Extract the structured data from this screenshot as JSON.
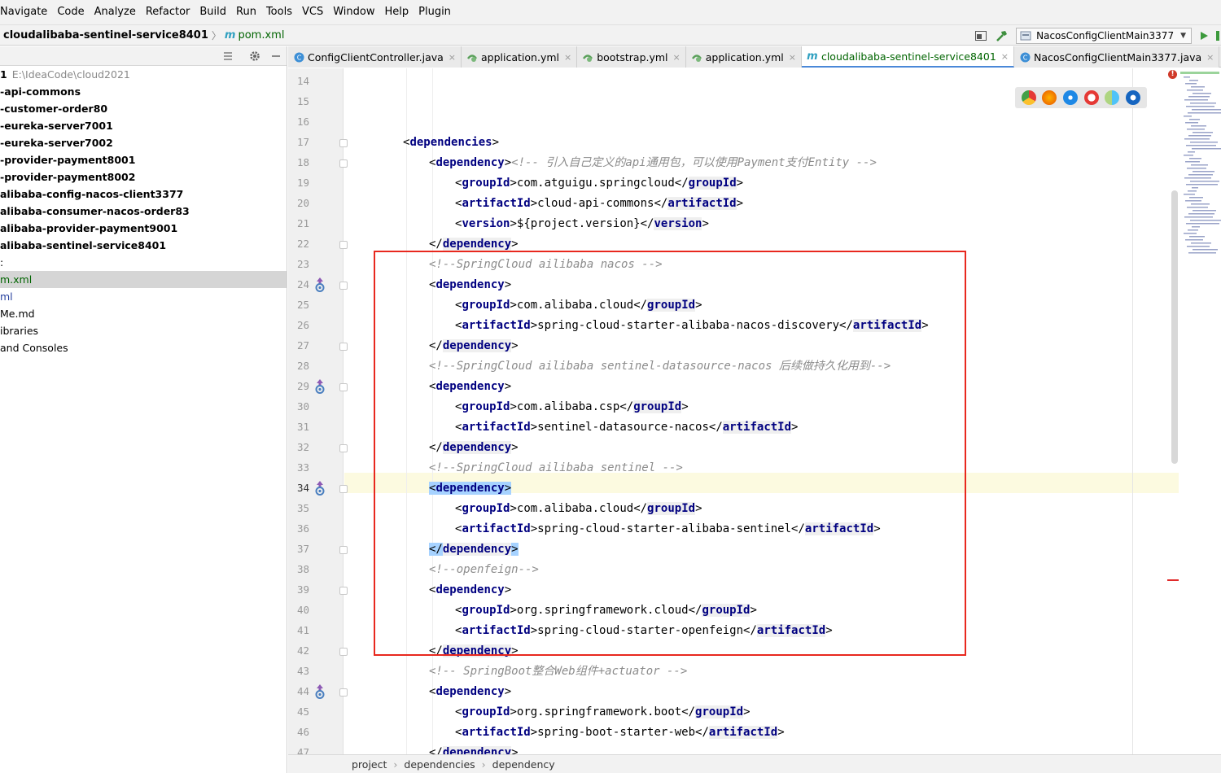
{
  "menu": [
    "Navigate",
    "Code",
    "Analyze",
    "Refactor",
    "Build",
    "Run",
    "Tools",
    "VCS",
    "Window",
    "Help",
    "Plugin"
  ],
  "nav": {
    "project": "cloudalibaba-sentinel-service8401",
    "file_prefix": "m",
    "file": "pom.xml",
    "run_config": "NacosConfigClientMain3377"
  },
  "project_tree": {
    "root_name": "1",
    "root_path": "E:\\IdeaCode\\cloud2021",
    "items": [
      "-api-commons",
      "-customer-order80",
      "-eureka-server7001",
      "-eureka-server7002",
      "-provider-payment8001",
      "-provider-payment8002",
      "alibaba-config-nacos-client3377",
      "alibaba-consumer-nacos-order83",
      "alibaba-provider-payment9001",
      "alibaba-sentinel-service8401",
      ":",
      "m.xml",
      "ml",
      "Me.md",
      "ibraries",
      " and Consoles"
    ]
  },
  "tabs": [
    {
      "label": "ConfigClientController.java",
      "icon": "java-class-icon"
    },
    {
      "label": "application.yml",
      "icon": "yml-icon"
    },
    {
      "label": "bootstrap.yml",
      "icon": "yml-icon"
    },
    {
      "label": "application.yml",
      "icon": "yml-icon"
    },
    {
      "label": "cloudalibaba-sentinel-service8401",
      "icon": "maven-icon",
      "active": true
    },
    {
      "label": "NacosConfigClientMain3377.java",
      "icon": "java-class-icon"
    }
  ],
  "code": {
    "line_numbers": [
      "14",
      "15",
      "16",
      "17",
      "18",
      "19",
      "20",
      "21",
      "22",
      "23",
      "24",
      "25",
      "26",
      "27",
      "28",
      "29",
      "30",
      "31",
      "32",
      "33",
      "34",
      "35",
      "36",
      "37",
      "38",
      "39",
      "40",
      "41",
      "42",
      "43",
      "44",
      "45",
      "46",
      "47"
    ],
    "current_line": "34",
    "lines": [
      {
        "ln": "14",
        "indent": 0,
        "parts": []
      },
      {
        "ln": "15",
        "indent": 0,
        "parts": []
      },
      {
        "ln": "16",
        "indent": 0,
        "parts": []
      },
      {
        "ln": "17",
        "indent": 1,
        "parts": [
          {
            "t": "open",
            "v": "dependencies"
          }
        ]
      },
      {
        "ln": "18",
        "indent": 2,
        "parts": [
          {
            "t": "open",
            "v": "dependency"
          },
          {
            "t": "cmt",
            "v": "<!-- 引入自己定义的api通用包，可以使用Payment支付Entity -->"
          }
        ]
      },
      {
        "ln": "19",
        "indent": 3,
        "parts": [
          {
            "t": "open",
            "v": "groupId"
          },
          {
            "t": "txt",
            "v": "com.atguigu.springcloud"
          },
          {
            "t": "close",
            "v": "groupId"
          }
        ]
      },
      {
        "ln": "20",
        "indent": 3,
        "parts": [
          {
            "t": "open",
            "v": "artifactId"
          },
          {
            "t": "txt",
            "v": "cloud-api-commons"
          },
          {
            "t": "close",
            "v": "artifactId"
          }
        ]
      },
      {
        "ln": "21",
        "indent": 3,
        "parts": [
          {
            "t": "open",
            "v": "version"
          },
          {
            "t": "txt",
            "v": "${project.version}"
          },
          {
            "t": "close",
            "v": "version"
          }
        ]
      },
      {
        "ln": "22",
        "indent": 2,
        "parts": [
          {
            "t": "close",
            "v": "dependency"
          }
        ]
      },
      {
        "ln": "23",
        "indent": 2,
        "parts": [
          {
            "t": "cmt",
            "v": "<!--SpringCloud ailibaba nacos -->"
          }
        ]
      },
      {
        "ln": "24",
        "indent": 2,
        "parts": [
          {
            "t": "open",
            "v": "dependency"
          }
        ]
      },
      {
        "ln": "25",
        "indent": 3,
        "parts": [
          {
            "t": "open",
            "v": "groupId"
          },
          {
            "t": "txt",
            "v": "com.alibaba.cloud"
          },
          {
            "t": "close",
            "v": "groupId"
          }
        ]
      },
      {
        "ln": "26",
        "indent": 3,
        "parts": [
          {
            "t": "open",
            "v": "artifactId"
          },
          {
            "t": "txt",
            "v": "spring-cloud-starter-alibaba-nacos-discovery"
          },
          {
            "t": "close",
            "v": "artifactId"
          }
        ]
      },
      {
        "ln": "27",
        "indent": 2,
        "parts": [
          {
            "t": "close",
            "v": "dependency"
          }
        ]
      },
      {
        "ln": "28",
        "indent": 2,
        "parts": [
          {
            "t": "cmt",
            "v": "<!--SpringCloud ailibaba sentinel-datasource-nacos 后续做持久化用到-->"
          }
        ]
      },
      {
        "ln": "29",
        "indent": 2,
        "parts": [
          {
            "t": "open",
            "v": "dependency"
          }
        ]
      },
      {
        "ln": "30",
        "indent": 3,
        "parts": [
          {
            "t": "open",
            "v": "groupId"
          },
          {
            "t": "txt",
            "v": "com.alibaba.csp"
          },
          {
            "t": "close",
            "v": "groupId"
          }
        ]
      },
      {
        "ln": "31",
        "indent": 3,
        "parts": [
          {
            "t": "open",
            "v": "artifactId"
          },
          {
            "t": "txt",
            "v": "sentinel-datasource-nacos"
          },
          {
            "t": "close",
            "v": "artifactId"
          }
        ]
      },
      {
        "ln": "32",
        "indent": 2,
        "parts": [
          {
            "t": "close",
            "v": "dependency"
          }
        ]
      },
      {
        "ln": "33",
        "indent": 2,
        "parts": [
          {
            "t": "cmt",
            "v": "<!--SpringCloud ailibaba sentinel -->"
          }
        ]
      },
      {
        "ln": "34",
        "indent": 2,
        "parts": [
          {
            "t": "open",
            "v": "dependency",
            "hl": true
          }
        ]
      },
      {
        "ln": "35",
        "indent": 3,
        "parts": [
          {
            "t": "open",
            "v": "groupId"
          },
          {
            "t": "txt",
            "v": "com.alibaba.cloud"
          },
          {
            "t": "close",
            "v": "groupId"
          }
        ]
      },
      {
        "ln": "36",
        "indent": 3,
        "parts": [
          {
            "t": "open",
            "v": "artifactId"
          },
          {
            "t": "txt",
            "v": "spring-cloud-starter-alibaba-sentinel"
          },
          {
            "t": "close",
            "v": "artifactId"
          }
        ]
      },
      {
        "ln": "37",
        "indent": 2,
        "parts": [
          {
            "t": "close",
            "v": "dependency",
            "hl": true
          }
        ]
      },
      {
        "ln": "38",
        "indent": 2,
        "parts": [
          {
            "t": "cmt",
            "v": "<!--openfeign-->"
          }
        ]
      },
      {
        "ln": "39",
        "indent": 2,
        "parts": [
          {
            "t": "open",
            "v": "dependency"
          }
        ]
      },
      {
        "ln": "40",
        "indent": 3,
        "parts": [
          {
            "t": "open",
            "v": "groupId"
          },
          {
            "t": "txt",
            "v": "org.springframework.cloud"
          },
          {
            "t": "close",
            "v": "groupId"
          }
        ]
      },
      {
        "ln": "41",
        "indent": 3,
        "parts": [
          {
            "t": "open",
            "v": "artifactId"
          },
          {
            "t": "txt",
            "v": "spring-cloud-starter-openfeign"
          },
          {
            "t": "close",
            "v": "artifactId"
          }
        ]
      },
      {
        "ln": "42",
        "indent": 2,
        "parts": [
          {
            "t": "close",
            "v": "dependency"
          }
        ]
      },
      {
        "ln": "43",
        "indent": 2,
        "parts": [
          {
            "t": "cmt",
            "v": "<!-- SpringBoot整合Web组件+actuator -->"
          }
        ]
      },
      {
        "ln": "44",
        "indent": 2,
        "parts": [
          {
            "t": "open",
            "v": "dependency"
          }
        ]
      },
      {
        "ln": "45",
        "indent": 3,
        "parts": [
          {
            "t": "open",
            "v": "groupId"
          },
          {
            "t": "txt",
            "v": "org.springframework.boot"
          },
          {
            "t": "close",
            "v": "groupId"
          }
        ]
      },
      {
        "ln": "46",
        "indent": 3,
        "parts": [
          {
            "t": "open",
            "v": "artifactId"
          },
          {
            "t": "txt",
            "v": "spring-boot-starter-web"
          },
          {
            "t": "close",
            "v": "artifactId"
          }
        ]
      },
      {
        "ln": "47",
        "indent": 2,
        "parts": [
          {
            "t": "close",
            "v": "dependency"
          }
        ]
      }
    ],
    "fold_lines": [
      "17",
      "18",
      "22",
      "24",
      "27",
      "29",
      "32",
      "34",
      "37",
      "39",
      "42",
      "44"
    ],
    "gutter_icon_lines": [
      "24",
      "29",
      "34",
      "44"
    ]
  },
  "browser_icons": [
    "chrome-icon",
    "firefox-icon",
    "safari-icon",
    "opera-icon",
    "browser-icon",
    "edge-icon"
  ],
  "status_breadcrumbs": [
    "project",
    "dependencies",
    "dependency"
  ],
  "colors": {
    "tag": "#000080",
    "comment": "#8c8c8c",
    "highlight": "#a6d2ff",
    "redbox": "#e8281e"
  }
}
